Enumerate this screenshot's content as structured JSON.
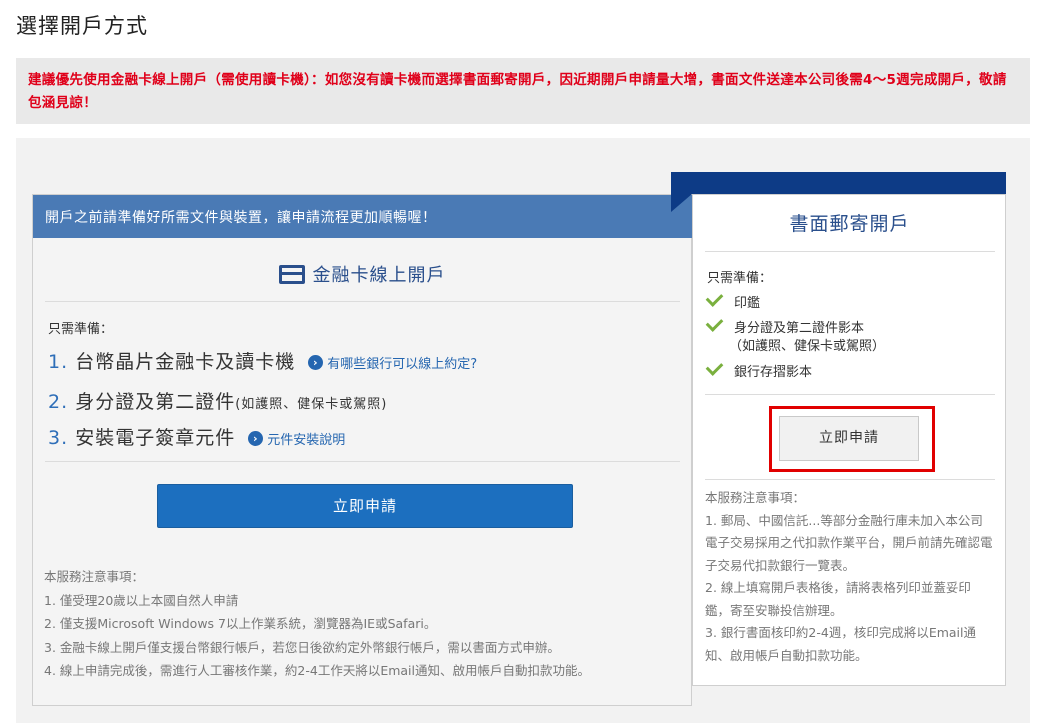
{
  "page_title": "選擇開戶方式",
  "notice": "建議優先使用金融卡線上開戶（需使用讀卡機）：如您沒有讀卡機而選擇書面郵寄開戶，因近期開戶申請量大增，書面文件送達本公司後需4～5週完成開戶，敬請包涵見諒！",
  "online": {
    "header": "開戶之前請準備好所需文件與裝置，讓申請流程更加順暢喔！",
    "title": "金融卡線上開戶",
    "prep_label": "只需準備：",
    "requirements": [
      {
        "num": "1.",
        "text": "台幣晶片金融卡及讀卡機",
        "sub": "",
        "link": "有哪些銀行可以線上約定?"
      },
      {
        "num": "2.",
        "text": "身分證及第二證件",
        "sub": "(如護照、健保卡或駕照)",
        "link": ""
      },
      {
        "num": "3.",
        "text": "安裝電子簽章元件",
        "sub": "",
        "link": "元件安裝說明"
      }
    ],
    "apply_label": "立即申請",
    "notes_title": "本服務注意事項：",
    "notes": [
      "1. 僅受理20歲以上本國自然人申請",
      "2. 僅支援Microsoft Windows 7以上作業系統，瀏覽器為IE或Safari。",
      "3. 金融卡線上開戶僅支援台幣銀行帳戶，若您日後欲約定外幣銀行帳戶，需以書面方式申辦。",
      "4. 線上申請完成後，需進行人工審核作業，約2-4工作天將以Email通知、啟用帳戶自動扣款功能。"
    ]
  },
  "paper": {
    "title": "書面郵寄開戶",
    "prep_label": "只需準備：",
    "items": [
      "印鑑",
      "身分證及第二證件影本",
      "銀行存摺影本"
    ],
    "item2_sub": "（如護照、健保卡或駕照）",
    "apply_label": "立即申請",
    "notes_title": "本服務注意事項：",
    "notes": [
      "1. 郵局、中國信託...等部分金融行庫未加入本公司電子交易採用之代扣款作業平台，開戶前請先確認電子交易代扣款銀行一覽表。",
      "2. 線上填寫開戶表格後，請將表格列印並蓋妥印鑑，寄至安聯投信辦理。",
      "3. 銀行書面核印約2-4週，核印完成將以Email通知、啟用帳戶自動扣款功能。"
    ]
  },
  "colors": {
    "accent": "#1c6fbf",
    "header_bg": "#4a7ab5",
    "tab": "#0d3b86",
    "notice": "#e0001a",
    "highlight": "#e10000",
    "check": "#7ab03e"
  }
}
